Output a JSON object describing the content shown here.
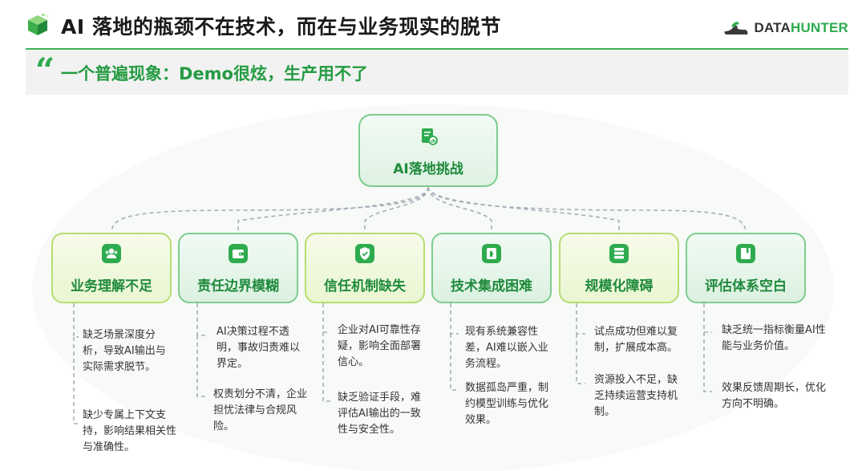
{
  "header": {
    "title": "AI 落地的瓶颈不在技术，而在与业务现实的脱节",
    "brand_prefix": "DATA",
    "brand_suffix": "HUNTER"
  },
  "subheader": {
    "quote_mark": "“",
    "text": "一个普遍现象：Demo很炫，生产用不了"
  },
  "diagram": {
    "root": {
      "label": "AI落地挑战",
      "icon": "document-chart-icon"
    },
    "categories": [
      {
        "label": "业务理解不足",
        "icon": "people-icon",
        "points": [
          "缺乏场景深度分析，导致AI输出与实际需求脱节。",
          "缺少专属上下文支持，影响结果相关性与准确性。"
        ]
      },
      {
        "label": "责任边界模糊",
        "icon": "wallet-icon",
        "points": [
          "AI决策过程不透明，事故归责难以界定。",
          "权责划分不清，企业担忧法律与合规风险。"
        ]
      },
      {
        "label": "信任机制缺失",
        "icon": "shield-check-icon",
        "points": [
          "企业对AI可靠性存疑，影响全面部署信心。",
          "缺乏验证手段，难评估AI输出的一致性与安全性。"
        ]
      },
      {
        "label": "技术集成困难",
        "icon": "puzzle-card-icon",
        "points": [
          "现有系统兼容性差，AI难以嵌入业务流程。",
          "数据孤岛严重，制约模型训练与优化效果。"
        ]
      },
      {
        "label": "规模化障碍",
        "icon": "stack-icon",
        "points": [
          "试点成功但难以复制，扩展成本高。",
          "资源投入不足，缺乏持续运营支持机制。"
        ]
      },
      {
        "label": "评估体系空白",
        "icon": "book-icon",
        "points": [
          "缺乏统一指标衡量AI性能与业务价值。",
          "效果反馈周期长，优化方向不明确。"
        ]
      }
    ]
  },
  "colors": {
    "accent_green": "#2eab4e",
    "title_text": "#1a1a1a",
    "category_text": "#1f8a3c",
    "connector_gray": "#a8adb8"
  }
}
